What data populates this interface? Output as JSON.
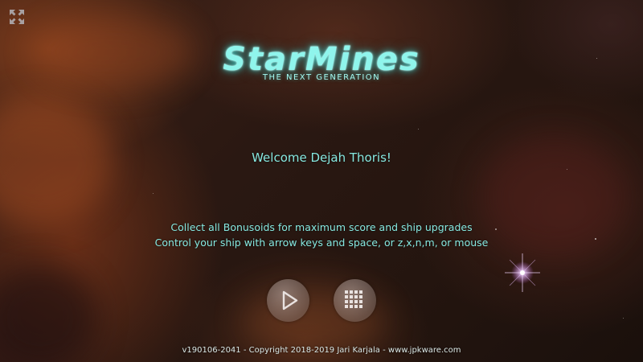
{
  "logo": {
    "title": "StarMines",
    "subtitle": "THE NEXT GENERATION"
  },
  "welcome": "Welcome Dejah Thoris!",
  "instructions": [
    "Collect all Bonusoids for maximum score and ship upgrades",
    "Control your ship with arrow keys and space, or z,x,n,m, or mouse"
  ],
  "buttons": {
    "fullscreen_icon": "fullscreen-arrows-icon",
    "play_icon": "play-triangle-icon",
    "levels_icon": "grid-dots-icon"
  },
  "footer": "v190106-2041 - Copyright 2018-2019 Jari Karjala - www.jpkware.com",
  "colors": {
    "accent": "#86e8e0",
    "logo_glow": "#3cdcd2",
    "footer_text": "#dbe8e6"
  }
}
